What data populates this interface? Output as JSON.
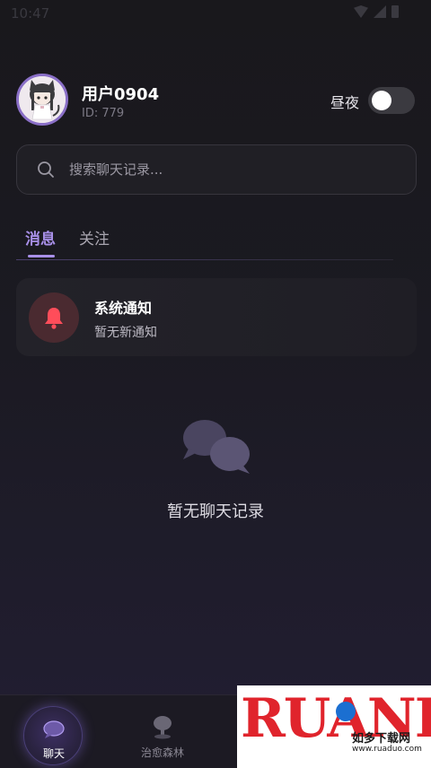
{
  "status_bar": {
    "time": "10:47"
  },
  "profile": {
    "username": "用户0904",
    "user_id": "ID: 779",
    "theme_label": "昼夜"
  },
  "search": {
    "placeholder": "搜索聊天记录..."
  },
  "tabs": [
    {
      "label": "消息",
      "active": true
    },
    {
      "label": "关注",
      "active": false
    }
  ],
  "notice": {
    "title": "系统通知",
    "subtitle": "暂无新通知"
  },
  "empty_state": {
    "text": "暂无聊天记录"
  },
  "bottom_nav": [
    {
      "label": "聊天",
      "active": true
    },
    {
      "label": "治愈森林",
      "active": false
    }
  ],
  "watermark": {
    "brand": "RUANDADO",
    "tagline": "如多下载网",
    "url": "www.ruaduo.com"
  },
  "colors": {
    "accent": "#a890e8",
    "background": "#19181c",
    "bell": "#ff4d5a"
  }
}
